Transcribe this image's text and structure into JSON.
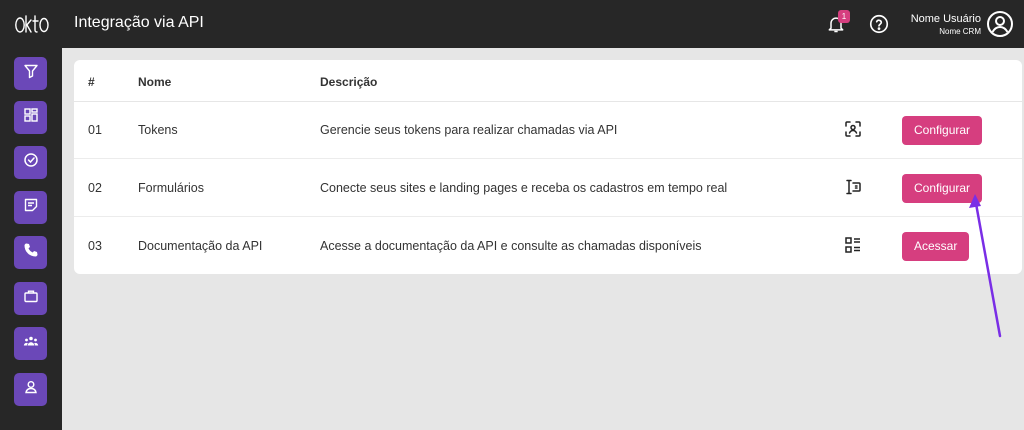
{
  "header": {
    "logo_text": "OKTO",
    "title": "Integração via API",
    "notifications_count": "1",
    "user_name": "Nome Usuário",
    "crm_name": "Nome CRM"
  },
  "sidebar": {
    "items": [
      {
        "icon": "filter-icon"
      },
      {
        "icon": "dashboard-icon"
      },
      {
        "icon": "check-circle-icon"
      },
      {
        "icon": "note-icon"
      },
      {
        "icon": "phone-icon"
      },
      {
        "icon": "briefcase-icon"
      },
      {
        "icon": "group-icon"
      },
      {
        "icon": "user-icon"
      }
    ]
  },
  "table": {
    "columns": [
      "#",
      "Nome",
      "Descrição"
    ],
    "rows": [
      {
        "num": "01",
        "name": "Tokens",
        "description": "Gerencie seus tokens para realizar chamadas via API",
        "icon": "face-scan-icon",
        "action": "Configurar"
      },
      {
        "num": "02",
        "name": "Formulários",
        "description": "Conecte seus sites e landing pages e receba os cadastros em tempo real",
        "icon": "form-input-icon",
        "action": "Configurar"
      },
      {
        "num": "03",
        "name": "Documentação da API",
        "description": "Acesse a documentação da API e consulte as chamadas disponíveis",
        "icon": "list-doc-icon",
        "action": "Acessar"
      }
    ]
  },
  "colors": {
    "topbar": "#272727",
    "sidebar_button": "#6b48b8",
    "action_button": "#d63e7f",
    "annotation_arrow": "#7a2ee6"
  }
}
